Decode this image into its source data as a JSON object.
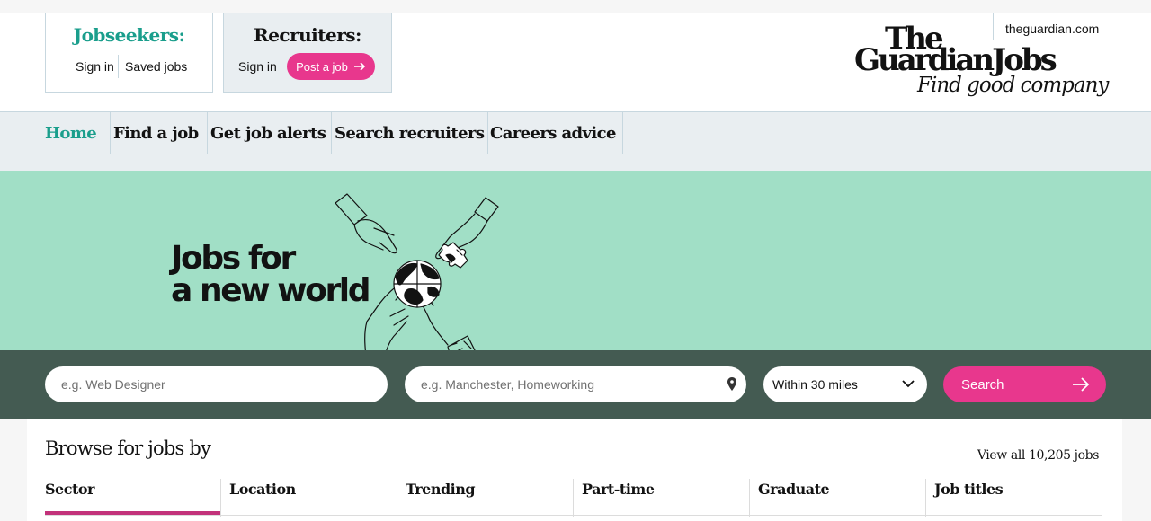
{
  "header": {
    "jobseekers": {
      "title": "Jobseekers:",
      "sign_in": "Sign in",
      "saved_jobs": "Saved jobs"
    },
    "recruiters": {
      "title": "Recruiters:",
      "sign_in": "Sign in",
      "post_job": "Post a job"
    },
    "site_link": "theguardian.com",
    "logo": {
      "line1": "The",
      "line2": "GuardianJobs",
      "tagline": "Find good company"
    }
  },
  "nav": {
    "items": [
      {
        "label": "Home",
        "active": true
      },
      {
        "label": "Find a job"
      },
      {
        "label": "Get job alerts"
      },
      {
        "label": "Search recruiters"
      },
      {
        "label": "Careers advice"
      }
    ]
  },
  "hero": {
    "line1": "Jobs for",
    "line2": "a new world"
  },
  "search": {
    "keyword_placeholder": "e.g. Web Designer",
    "location_placeholder": "e.g. Manchester, Homeworking",
    "distance_value": "Within 30 miles",
    "button_label": "Search"
  },
  "browse": {
    "title": "Browse for jobs by",
    "view_all": "View all 10,205 jobs",
    "tabs": [
      "Sector",
      "Location",
      "Trending",
      "Part-time",
      "Graduate",
      "Job titles"
    ],
    "active_tab": "Sector"
  },
  "colors": {
    "teal": "#1a9e8c",
    "pink": "#e8378d",
    "hero_bg": "#a1dfc6",
    "search_band": "#445b52",
    "nav_bg": "#e9eef1"
  },
  "icons": [
    "arrow-right-icon",
    "location-pin-icon",
    "chevron-down-icon"
  ]
}
